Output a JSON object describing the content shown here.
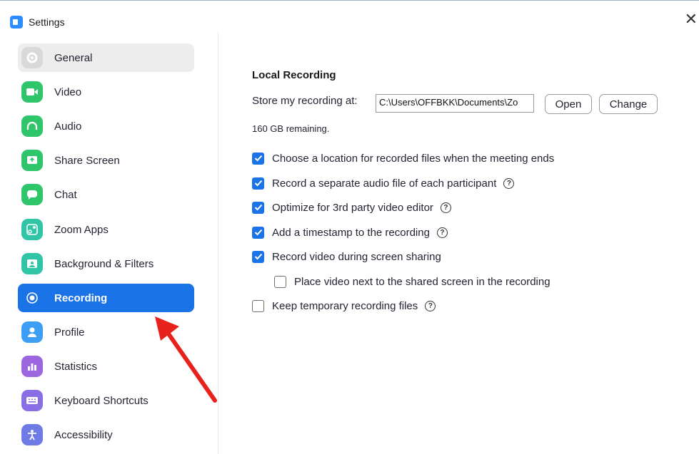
{
  "window": {
    "title": "Settings",
    "close_glyph": "✕"
  },
  "sidebar": {
    "items": [
      {
        "label": "General",
        "icon": "gear-icon",
        "color": "#d9d9d9"
      },
      {
        "label": "Video",
        "icon": "video-icon",
        "color": "#2fc56a"
      },
      {
        "label": "Audio",
        "icon": "headphones-icon",
        "color": "#2fc56a"
      },
      {
        "label": "Share Screen",
        "icon": "share-screen-icon",
        "color": "#2fc56a"
      },
      {
        "label": "Chat",
        "icon": "chat-icon",
        "color": "#2fc56a"
      },
      {
        "label": "Zoom Apps",
        "icon": "apps-icon",
        "color": "#2fc5a6"
      },
      {
        "label": "Background & Filters",
        "icon": "background-icon",
        "color": "#2fc5a6"
      },
      {
        "label": "Recording",
        "icon": "record-icon",
        "color": "#1b73e8"
      },
      {
        "label": "Profile",
        "icon": "profile-icon",
        "color": "#3d9ef5"
      },
      {
        "label": "Statistics",
        "icon": "statistics-icon",
        "color": "#9c66e0"
      },
      {
        "label": "Keyboard Shortcuts",
        "icon": "keyboard-icon",
        "color": "#8a6ee6"
      },
      {
        "label": "Accessibility",
        "icon": "accessibility-icon",
        "color": "#6e7ae6"
      }
    ]
  },
  "recording": {
    "section_title": "Local Recording",
    "store_label": "Store my recording at:",
    "path_value": "C:\\Users\\OFFBKK\\Documents\\Zo",
    "open_label": "Open",
    "change_label": "Change",
    "remaining": "160 GB remaining.",
    "options": [
      {
        "label": "Choose a location for recorded files when the meeting ends",
        "checked": true,
        "help": false
      },
      {
        "label": "Record a separate audio file of each participant",
        "checked": true,
        "help": true
      },
      {
        "label": "Optimize for 3rd party video editor",
        "checked": true,
        "help": true
      },
      {
        "label": "Add a timestamp to the recording",
        "checked": true,
        "help": true
      },
      {
        "label": "Record video during screen sharing",
        "checked": true,
        "help": false
      },
      {
        "label": "Place video next to the shared screen in the recording",
        "checked": false,
        "help": false
      },
      {
        "label": "Keep temporary recording files",
        "checked": false,
        "help": true
      }
    ],
    "help_glyph": "?"
  },
  "annotation": {
    "arrow_color": "#e8211d"
  }
}
